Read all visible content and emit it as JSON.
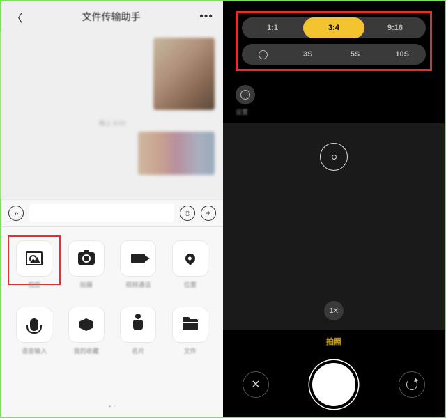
{
  "left": {
    "header": {
      "title": "文件传输助手"
    },
    "timestamp": "晚上 8:00",
    "attachments": [
      {
        "key": "photo",
        "label": "相册"
      },
      {
        "key": "camera",
        "label": "拍摄"
      },
      {
        "key": "video",
        "label": "视频通话"
      },
      {
        "key": "location",
        "label": "位置"
      },
      {
        "key": "voice",
        "label": "语音输入"
      },
      {
        "key": "fav",
        "label": "我的收藏"
      },
      {
        "key": "contact",
        "label": "名片"
      },
      {
        "key": "file",
        "label": "文件"
      }
    ],
    "highlighted_attachment_index": 0
  },
  "right": {
    "aspect_ratios": [
      "1:1",
      "3:4",
      "9:16"
    ],
    "aspect_active_index": 1,
    "timer_options": [
      "3S",
      "5S",
      "10S"
    ],
    "timer_icon": "clock-icon",
    "settings_label": "设置",
    "zoom": "1X",
    "mode": "拍照",
    "close_label": "✕",
    "colors": {
      "accent": "#f4c430",
      "highlight_box": "#e03030"
    }
  }
}
